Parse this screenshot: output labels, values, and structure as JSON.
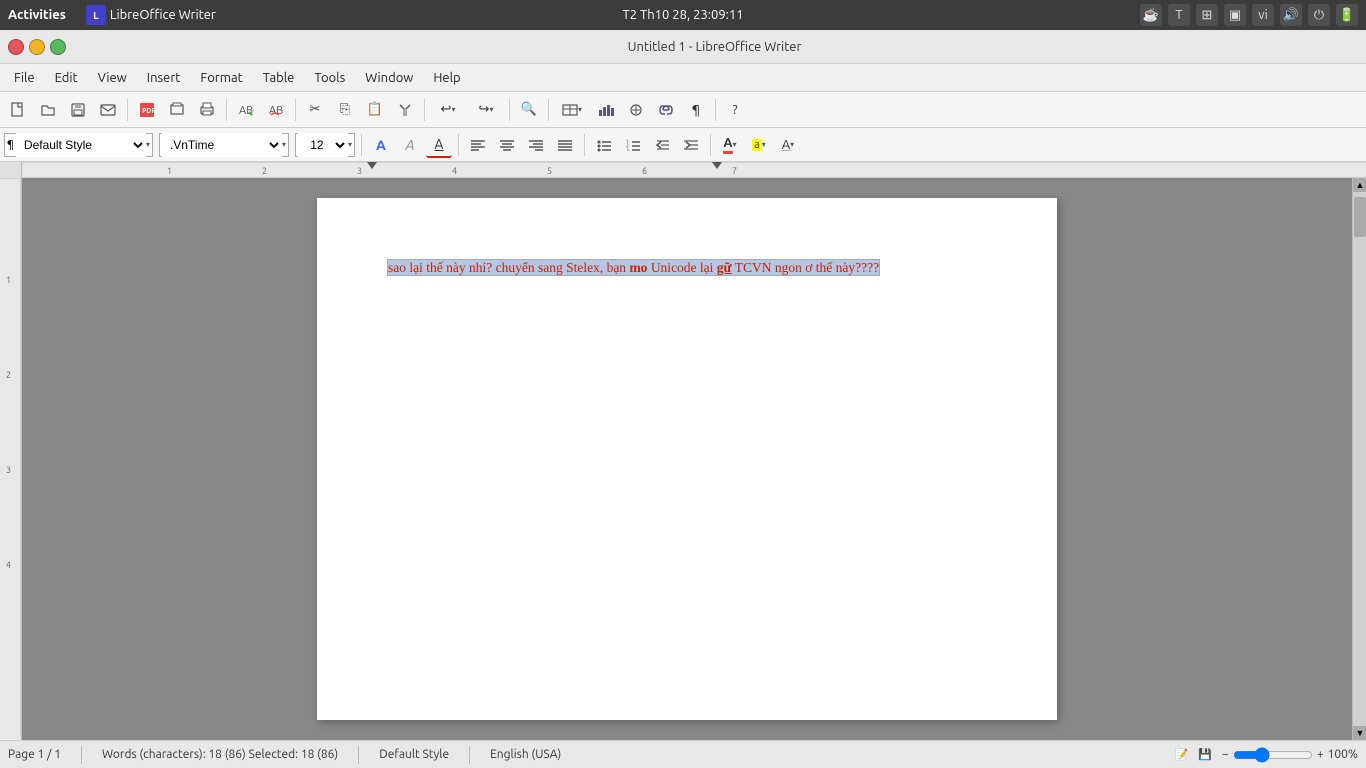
{
  "titlebar": {
    "activities": "Activities",
    "app_name": "LibreOffice Writer",
    "datetime": "T2 Th10 28, 23:09:11",
    "input_method": "vi"
  },
  "window": {
    "title": "Untitled 1 - LibreOffice Writer"
  },
  "menubar": {
    "items": [
      "File",
      "Edit",
      "View",
      "Insert",
      "Format",
      "Table",
      "Tools",
      "Window",
      "Help"
    ]
  },
  "toolbar1": {
    "buttons": [
      "new",
      "open",
      "save",
      "email",
      "export-pdf",
      "print-preview",
      "print",
      "spellcheck",
      "spellcheck2",
      "cut",
      "copy",
      "paste",
      "paste-special",
      "clone",
      "undo",
      "redo",
      "find",
      "insert-table",
      "insert-chart",
      "insert-object",
      "insert-hyperlink",
      "nonprinting",
      "help"
    ]
  },
  "toolbar2": {
    "style": "Default Style",
    "font": ".VnTime",
    "size": "12",
    "buttons": [
      "bold",
      "italic",
      "underline",
      "align-left",
      "align-center",
      "align-right",
      "justify",
      "list-unordered",
      "list-ordered",
      "indent-less",
      "indent-more",
      "font-color",
      "highlight",
      "character-bg"
    ]
  },
  "document": {
    "content": "sao lại thế này nhỉ? chuyển sang Stelex, bạn mo Unicode lại gữ TCVN ngon ơ thế này????",
    "selected": true
  },
  "statusbar": {
    "page_info": "Page 1 / 1",
    "word_info": "Words (characters): 18 (86)  Selected: 18 (86)",
    "style": "Default Style",
    "language": "English (USA)",
    "zoom": "100%"
  }
}
